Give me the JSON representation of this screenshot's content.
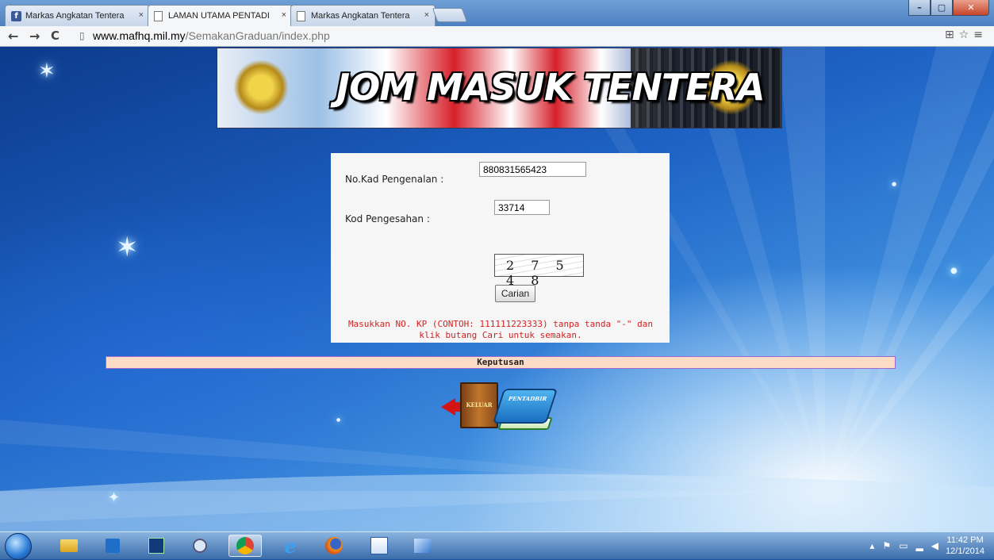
{
  "browser": {
    "tabs": [
      {
        "label": "Markas Angkatan Tentera",
        "close": "×",
        "icon": "facebook-icon",
        "active": false
      },
      {
        "label": "LAMAN UTAMA PENTADI",
        "close": "×",
        "icon": "page-icon",
        "active": true
      },
      {
        "label": "Markas Angkatan Tentera",
        "close": "×",
        "icon": "page-icon",
        "active": false
      }
    ],
    "url_host": "www.mafhq.mil.my",
    "url_path": "/SemakanGraduan/index.php",
    "window_controls": {
      "minimize": "–",
      "maximize": "▢",
      "close": "✕"
    }
  },
  "page": {
    "banner_title": "JOM MASUK TENTERA",
    "form": {
      "ic_label": "No.Kad Pengenalan :",
      "ic_value": "880831565423",
      "code_label": "Kod Pengesahan :",
      "code_value": "33714",
      "captcha_text": "2 7 5 4 8",
      "search_button": "Carian",
      "instructions": "Masukkan NO. KP (CONTOH: 111111223333) tanpa tanda \"-\" dan klik butang Cari untuk semakan."
    },
    "result_header": "Keputusan",
    "exit_icon_label": "KELUAR",
    "admin_icon_label": "PENTADBIR"
  },
  "taskbar": {
    "time": "11:42 PM",
    "date": "12/1/2014"
  },
  "colors": {
    "instruction_text": "#d42020",
    "result_bar": "#fcdcc6",
    "result_border": "#9a6ad0"
  }
}
